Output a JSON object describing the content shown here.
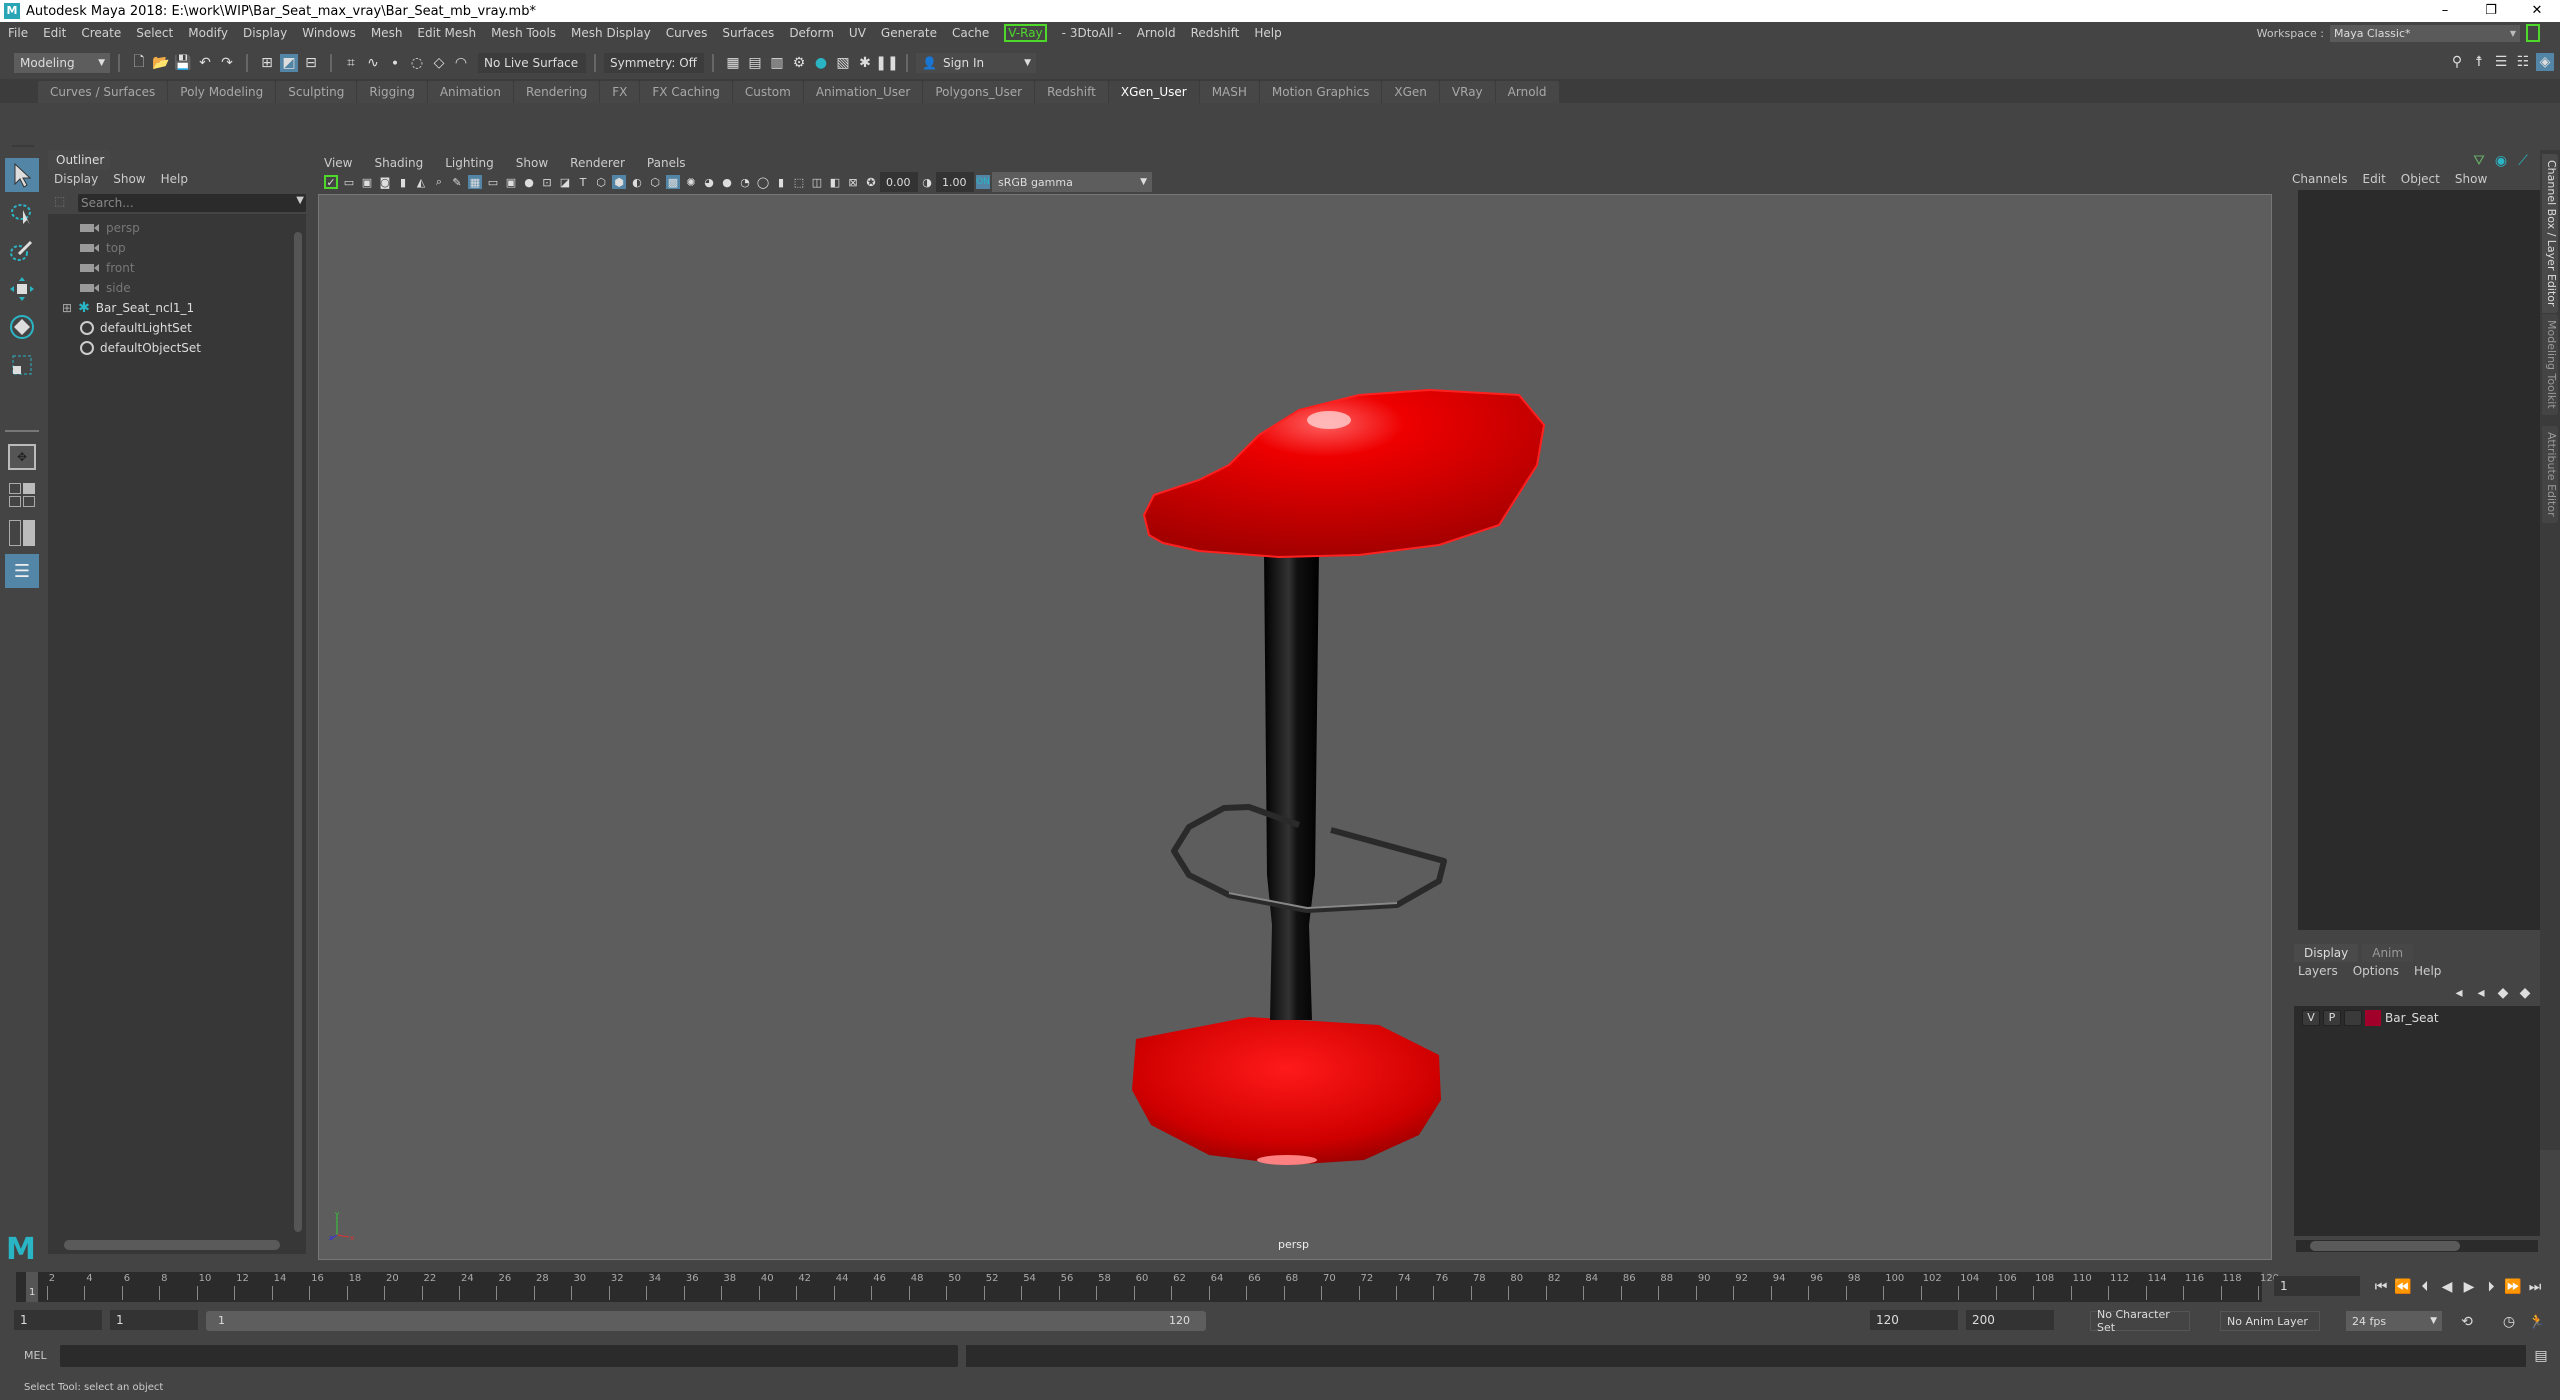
{
  "window": {
    "title": "Autodesk Maya 2018: E:\\work\\WIP\\Bar_Seat_max_vray\\Bar_Seat_mb_vray.mb*",
    "controls": [
      "–",
      "❐",
      "✕"
    ]
  },
  "menubar": {
    "items": [
      "File",
      "Edit",
      "Create",
      "Select",
      "Modify",
      "Display",
      "Windows",
      "Mesh",
      "Edit Mesh",
      "Mesh Tools",
      "Mesh Display",
      "Curves",
      "Surfaces",
      "Deform",
      "UV",
      "Generate",
      "Cache"
    ],
    "vray": "V-Ray",
    "items2": [
      "- 3DtoAll -",
      "Arnold",
      "Redshift",
      "Help"
    ],
    "workspace_label": "Workspace :",
    "workspace_value": "Maya Classic*"
  },
  "statusline": {
    "mode": "Modeling",
    "live_surface": "No Live Surface",
    "symmetry": "Symmetry: Off",
    "sign_in": "Sign In"
  },
  "shelf": {
    "tabs": [
      "Curves / Surfaces",
      "Poly Modeling",
      "Sculpting",
      "Rigging",
      "Animation",
      "Rendering",
      "FX",
      "FX Caching",
      "Custom",
      "Animation_User",
      "Polygons_User",
      "Redshift",
      "XGen_User",
      "MASH",
      "Motion Graphics",
      "XGen",
      "VRay",
      "Arnold"
    ],
    "active_tab": "XGen_User"
  },
  "outliner": {
    "title": "Outliner",
    "menu": [
      "Display",
      "Show",
      "Help"
    ],
    "search_placeholder": "Search...",
    "items": [
      {
        "label": "persp",
        "type": "camera",
        "dim": true
      },
      {
        "label": "top",
        "type": "camera",
        "dim": true
      },
      {
        "label": "front",
        "type": "camera",
        "dim": true
      },
      {
        "label": "side",
        "type": "camera",
        "dim": true
      },
      {
        "label": "Bar_Seat_ncl1_1",
        "type": "group",
        "dim": false
      },
      {
        "label": "defaultLightSet",
        "type": "set",
        "dim": false
      },
      {
        "label": "defaultObjectSet",
        "type": "set",
        "dim": false
      }
    ]
  },
  "viewport": {
    "menu": [
      "View",
      "Shading",
      "Lighting",
      "Show",
      "Renderer",
      "Panels"
    ],
    "exposure": "0.00",
    "gamma": "1.00",
    "color_space": "sRGB gamma",
    "camera_label": "persp",
    "axis": {
      "x": "x",
      "y": "y",
      "z": "z"
    }
  },
  "channelbox": {
    "menu": [
      "Channels",
      "Edit",
      "Object",
      "Show"
    ],
    "side_tabs": [
      "Channel Box / Layer Editor",
      "Modeling Toolkit",
      "Attribute Editor"
    ]
  },
  "layers": {
    "tabs": [
      "Display",
      "Anim"
    ],
    "menu": [
      "Layers",
      "Options",
      "Help"
    ],
    "rows": [
      {
        "v": "V",
        "p": "P",
        "name": "Bar_Seat",
        "color": "#a0002a"
      }
    ]
  },
  "timeline": {
    "start": 1,
    "end": 120,
    "step": 2,
    "current_frame": "1"
  },
  "range": {
    "start": "1",
    "playback_start": "1",
    "slider_start": "1",
    "slider_end": "120",
    "playback_end": "120",
    "end": "200",
    "character_set": "No Character Set",
    "anim_layer": "No Anim Layer",
    "fps": "24 fps"
  },
  "cmdline": {
    "label": "MEL"
  },
  "helpline": {
    "text": "Select Tool: select an object"
  },
  "colors": {
    "accent": "#5285a6",
    "vray_green": "#4ed82a",
    "stool_red": "#e00000"
  }
}
